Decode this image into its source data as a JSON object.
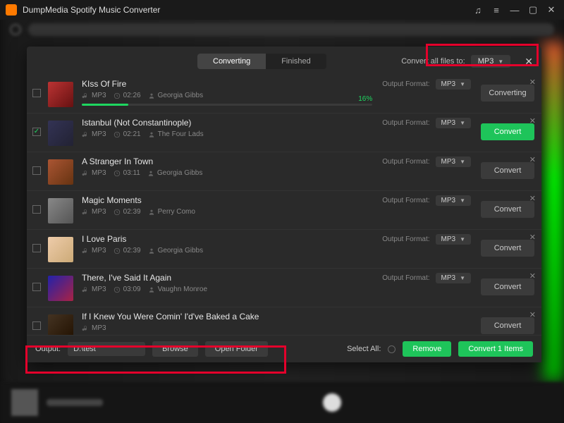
{
  "app": {
    "title": "DumpMedia Spotify Music Converter"
  },
  "tabs": {
    "converting": "Converting",
    "finished": "Finished"
  },
  "convert_all": {
    "label": "Convert all files to:",
    "format": "MP3"
  },
  "output_format_label": "Output Format:",
  "tracks": [
    {
      "title": "KIss Of Fire",
      "codec": "MP3",
      "duration": "02:26",
      "artist": "Georgia Gibbs",
      "format": "MP3",
      "status": "Converting",
      "progress": "16%",
      "checked": false
    },
    {
      "title": "Istanbul (Not Constantinople)",
      "codec": "MP3",
      "duration": "02:21",
      "artist": "The Four Lads",
      "format": "MP3",
      "status": "Convert",
      "checked": true
    },
    {
      "title": "A Stranger In Town",
      "codec": "MP3",
      "duration": "03:11",
      "artist": "Georgia Gibbs",
      "format": "MP3",
      "status": "Convert",
      "checked": false
    },
    {
      "title": "Magic Moments",
      "codec": "MP3",
      "duration": "02:39",
      "artist": "Perry Como",
      "format": "MP3",
      "status": "Convert",
      "checked": false
    },
    {
      "title": "I Love Paris",
      "codec": "MP3",
      "duration": "02:39",
      "artist": "Georgia Gibbs",
      "format": "MP3",
      "status": "Convert",
      "checked": false
    },
    {
      "title": "There, I've Said It Again",
      "codec": "MP3",
      "duration": "03:09",
      "artist": "Vaughn Monroe",
      "format": "MP3",
      "status": "Convert",
      "checked": false
    },
    {
      "title": "If I Knew You Were Comin' I'd've Baked a Cake",
      "codec": "MP3",
      "duration": "",
      "artist": "",
      "format": "",
      "status": "Convert",
      "checked": false
    }
  ],
  "footer": {
    "output_label": "Output:",
    "output_path": "D:\\test",
    "browse": "Browse",
    "open_folder": "Open Folder",
    "select_all": "Select All:",
    "remove": "Remove",
    "convert_n": "Convert 1 Items"
  },
  "art_colors": [
    "linear-gradient(135deg,#b33,#611)",
    "linear-gradient(135deg,#335,#223)",
    "linear-gradient(135deg,#a53,#631)",
    "linear-gradient(135deg,#888,#555)",
    "linear-gradient(135deg,#eca,#ca7)",
    "linear-gradient(135deg,#22a,#a24)",
    "linear-gradient(135deg,#432,#210)"
  ]
}
